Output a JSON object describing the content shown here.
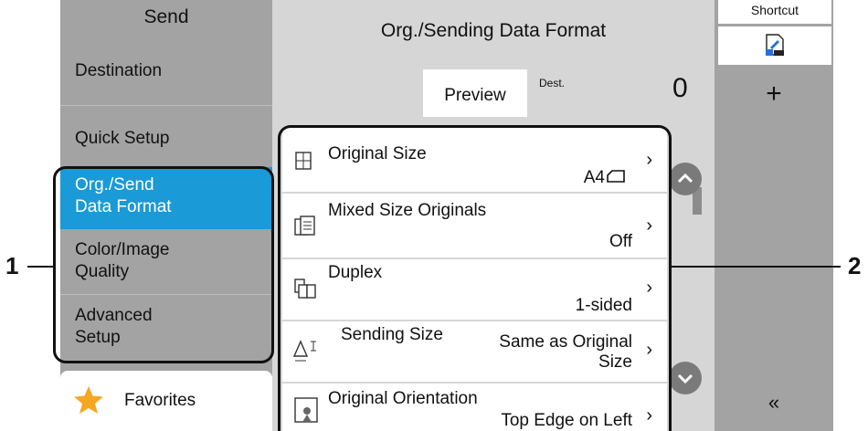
{
  "sidebar": {
    "title": "Send",
    "items": [
      {
        "label": "Destination"
      },
      {
        "label": "Quick Setup"
      },
      {
        "label_line1": "Org./Send",
        "label_line2": "Data Format",
        "selected": true
      },
      {
        "label_line1": "Color/Image",
        "label_line2": "Quality"
      },
      {
        "label_line1": "Advanced",
        "label_line2": "Setup"
      }
    ],
    "favorites": "Favorites"
  },
  "panel": {
    "title": "Org./Sending Data Format",
    "preview_button": "Preview",
    "dest_label": "Dest.",
    "dest_count": "0"
  },
  "settings": [
    {
      "name": "Original Size",
      "value": "A4",
      "icon": "original-size-icon"
    },
    {
      "name": "Mixed Size Originals",
      "value": "Off",
      "icon": "mixed-size-icon"
    },
    {
      "name": "Duplex",
      "value": "1-sided",
      "icon": "duplex-icon"
    },
    {
      "name": "Sending Size",
      "value_line1": "Same as Original",
      "value_line2": "Size",
      "icon": "sending-size-icon"
    },
    {
      "name": "Original Orientation",
      "value": "Top Edge on Left",
      "icon": "orientation-icon"
    }
  ],
  "right": {
    "shortcut_label": "Shortcut",
    "plus": "+",
    "collapse": "«"
  },
  "callouts": {
    "left": "1",
    "right": "2"
  },
  "colors": {
    "selected": "#1a9ad6",
    "sidebar": "#a3a3a3",
    "panel": "#d6d6d6",
    "star": "#f5a623"
  }
}
